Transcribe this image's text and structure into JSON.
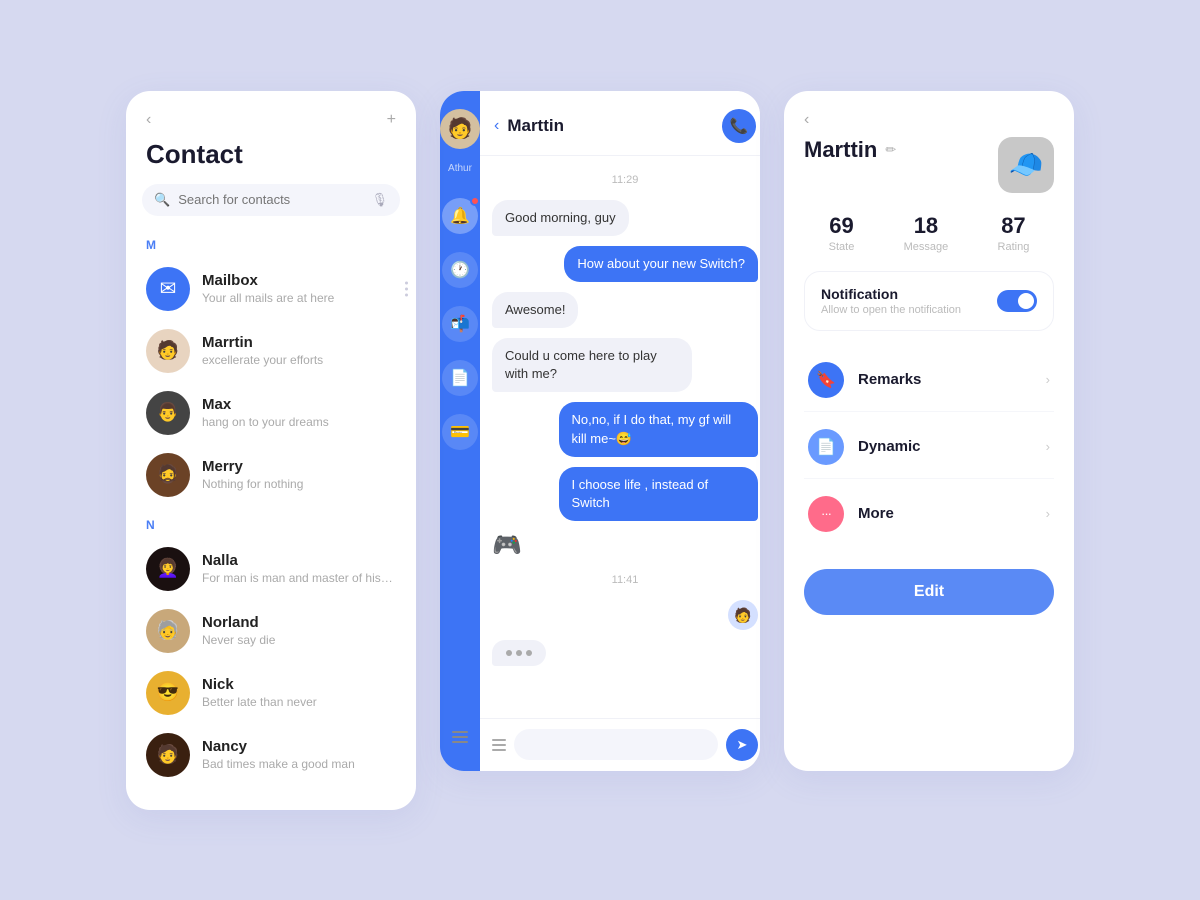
{
  "bg": "#d6d9f0",
  "contact_panel": {
    "back_label": "‹",
    "add_label": "+",
    "title": "Contact",
    "search_placeholder": "Search for contacts",
    "section_m": "M",
    "section_n": "N",
    "contacts": [
      {
        "id": "mailbox",
        "name": "Mailbox",
        "sub": "Your all mails are at here",
        "type": "mailbox"
      },
      {
        "id": "marrtin",
        "name": "Marrtin",
        "sub": "excellerate your efforts",
        "type": "avatar",
        "av_class": "av-marrtin",
        "emoji": "🧑"
      },
      {
        "id": "max",
        "name": "Max",
        "sub": "hang on to your dreams",
        "type": "avatar",
        "av_class": "av-max",
        "emoji": "👨"
      },
      {
        "id": "merry",
        "name": "Merry",
        "sub": "Nothing for nothing",
        "type": "avatar",
        "av_class": "av-merry",
        "emoji": "🧔"
      }
    ],
    "contacts_n": [
      {
        "id": "nalla",
        "name": "Nalla",
        "sub": "For man is man and master of his fate",
        "type": "avatar",
        "av_class": "av-nalla",
        "emoji": "👩"
      },
      {
        "id": "norland",
        "name": "Norland",
        "sub": "Never say die",
        "type": "avatar",
        "av_class": "av-norland",
        "emoji": "🧓"
      },
      {
        "id": "nick",
        "name": "Nick",
        "sub": "Better late than never",
        "type": "avatar",
        "av_class": "av-nick",
        "emoji": "😎"
      },
      {
        "id": "nancy",
        "name": "Nancy",
        "sub": "Bad times make a good man",
        "type": "avatar",
        "av_class": "av-nancy",
        "emoji": "🧑"
      }
    ]
  },
  "chat_panel": {
    "user_name": "Marttin",
    "back_label": "‹",
    "time1": "11:29",
    "time2": "11:41",
    "messages": [
      {
        "id": "m1",
        "text": "Good morning, guy",
        "side": "left"
      },
      {
        "id": "m2",
        "text": "How about your new Switch?",
        "side": "right"
      },
      {
        "id": "m3",
        "text": "Awesome!",
        "side": "left"
      },
      {
        "id": "m4",
        "text": "Could u come here to play with me?",
        "side": "left"
      },
      {
        "id": "m5",
        "text": "No,no, if I do that, my gf will kill me~😅",
        "side": "right"
      },
      {
        "id": "m6",
        "text": "I choose life , instead of Switch",
        "side": "right"
      }
    ],
    "input_placeholder": ""
  },
  "profile_panel": {
    "back_label": "‹",
    "name": "Marttin",
    "edit_icon": "✏",
    "stats": [
      {
        "value": "69",
        "label": "State"
      },
      {
        "value": "18",
        "label": "Message"
      },
      {
        "value": "87",
        "label": "Rating"
      }
    ],
    "notification": {
      "title": "Notification",
      "sub": "Allow to open the notification"
    },
    "menu_items": [
      {
        "id": "remarks",
        "label": "Remarks",
        "icon": "🔖",
        "icon_class": "icon-blue"
      },
      {
        "id": "dynamic",
        "label": "Dynamic",
        "icon": "📄",
        "icon_class": "icon-blue2"
      },
      {
        "id": "more",
        "label": "More",
        "icon": "···",
        "icon_class": "icon-pink"
      }
    ],
    "edit_btn_label": "Edit"
  }
}
